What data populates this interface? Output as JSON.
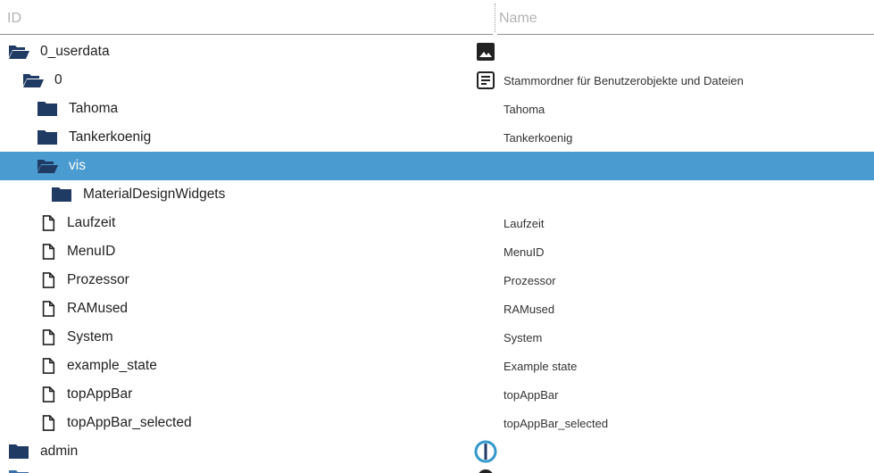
{
  "header": {
    "id_placeholder": "ID",
    "name_placeholder": "Name"
  },
  "colors": {
    "folder": "#1f3a63",
    "selected": "#4a9bd0"
  },
  "rows": [
    {
      "id": "0_userdata",
      "name": "",
      "icon": "folder-open-icon",
      "name_icon": "image-icon"
    },
    {
      "id": "0",
      "name": "Stammordner für Benutzerobjekte und Dateien",
      "icon": "folder-open-icon",
      "name_icon": "document-icon"
    },
    {
      "id": "Tahoma",
      "name": "Tahoma",
      "icon": "folder-icon"
    },
    {
      "id": "Tankerkoenig",
      "name": "Tankerkoenig",
      "icon": "folder-icon"
    },
    {
      "id": "vis",
      "name": "",
      "icon": "folder-open-icon",
      "selected": true
    },
    {
      "id": "MaterialDesignWidgets",
      "name": "",
      "icon": "folder-icon"
    },
    {
      "id": "Laufzeit",
      "name": "Laufzeit",
      "icon": "file-icon"
    },
    {
      "id": "MenuID",
      "name": "MenuID",
      "icon": "file-icon"
    },
    {
      "id": "Prozessor",
      "name": "Prozessor",
      "icon": "file-icon"
    },
    {
      "id": "RAMused",
      "name": "RAMused",
      "icon": "file-icon"
    },
    {
      "id": "System",
      "name": "System",
      "icon": "file-icon"
    },
    {
      "id": "example_state",
      "name": "Example state",
      "icon": "file-icon"
    },
    {
      "id": "topAppBar",
      "name": "topAppBar",
      "icon": "file-icon"
    },
    {
      "id": "topAppBar_selected",
      "name": "topAppBar_selected",
      "icon": "file-icon"
    },
    {
      "id": "admin",
      "name": "",
      "icon": "folder-icon",
      "name_icon": "iobroker-icon"
    }
  ]
}
